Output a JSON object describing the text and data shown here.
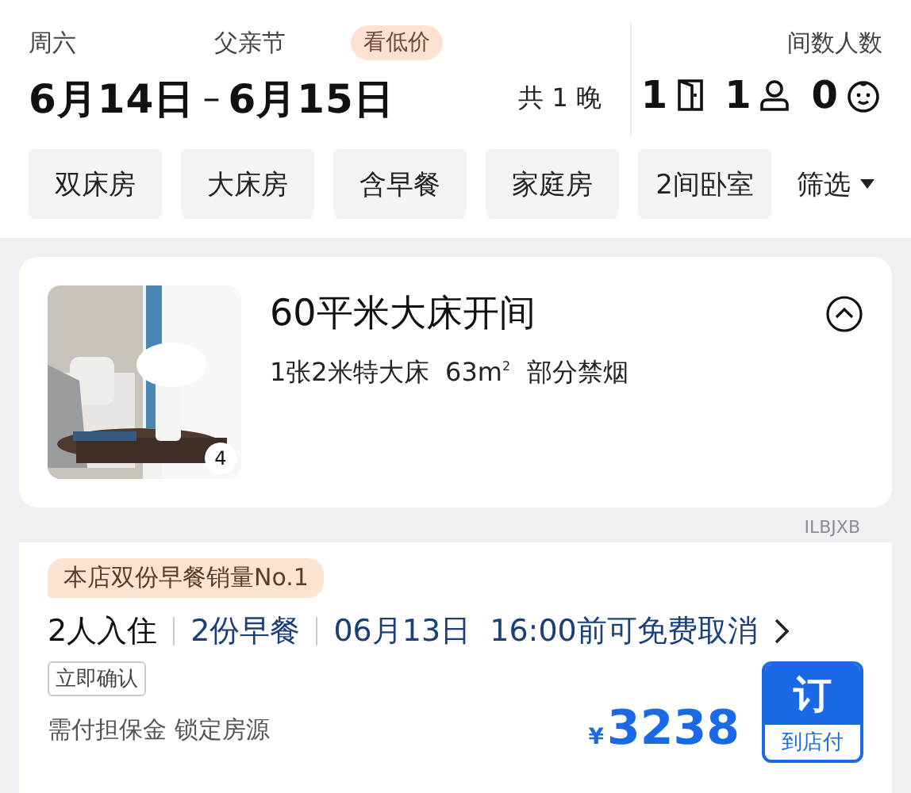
{
  "header": {
    "checkin_day": "周六",
    "holiday": "父亲节",
    "promo_badge": "看低价",
    "date_range": {
      "start": "6月14日",
      "separator": "–",
      "end": "6月15日"
    },
    "nights": "共 1 晚",
    "guests_label": "间数人数",
    "rooms": "1",
    "adults": "1",
    "children": "0"
  },
  "filters": {
    "chips": [
      {
        "label": "双床房"
      },
      {
        "label": "大床房"
      },
      {
        "label": "含早餐"
      },
      {
        "label": "家庭房"
      },
      {
        "label": "2间卧室"
      }
    ],
    "filter_button": "筛选"
  },
  "room": {
    "photo": {
      "count": "4"
    },
    "name": "60平米大床开间",
    "details": "1张2米特大床  63m$^{2}$  部分禁烟",
    "expanded": true,
    "code": "ILBJXB"
  },
  "offer": {
    "badge": "本店双份早餐销量No.1",
    "occupancy": "2人入住",
    "breakfast": "2份早餐",
    "cancellation": "06月13日  16:00前可免费取消",
    "tag": "立即确认",
    "note": "需付担保金 锁定房源",
    "currency": "¥",
    "price": "3238",
    "book_button": {
      "label": "订",
      "sub": "到店付"
    }
  }
}
